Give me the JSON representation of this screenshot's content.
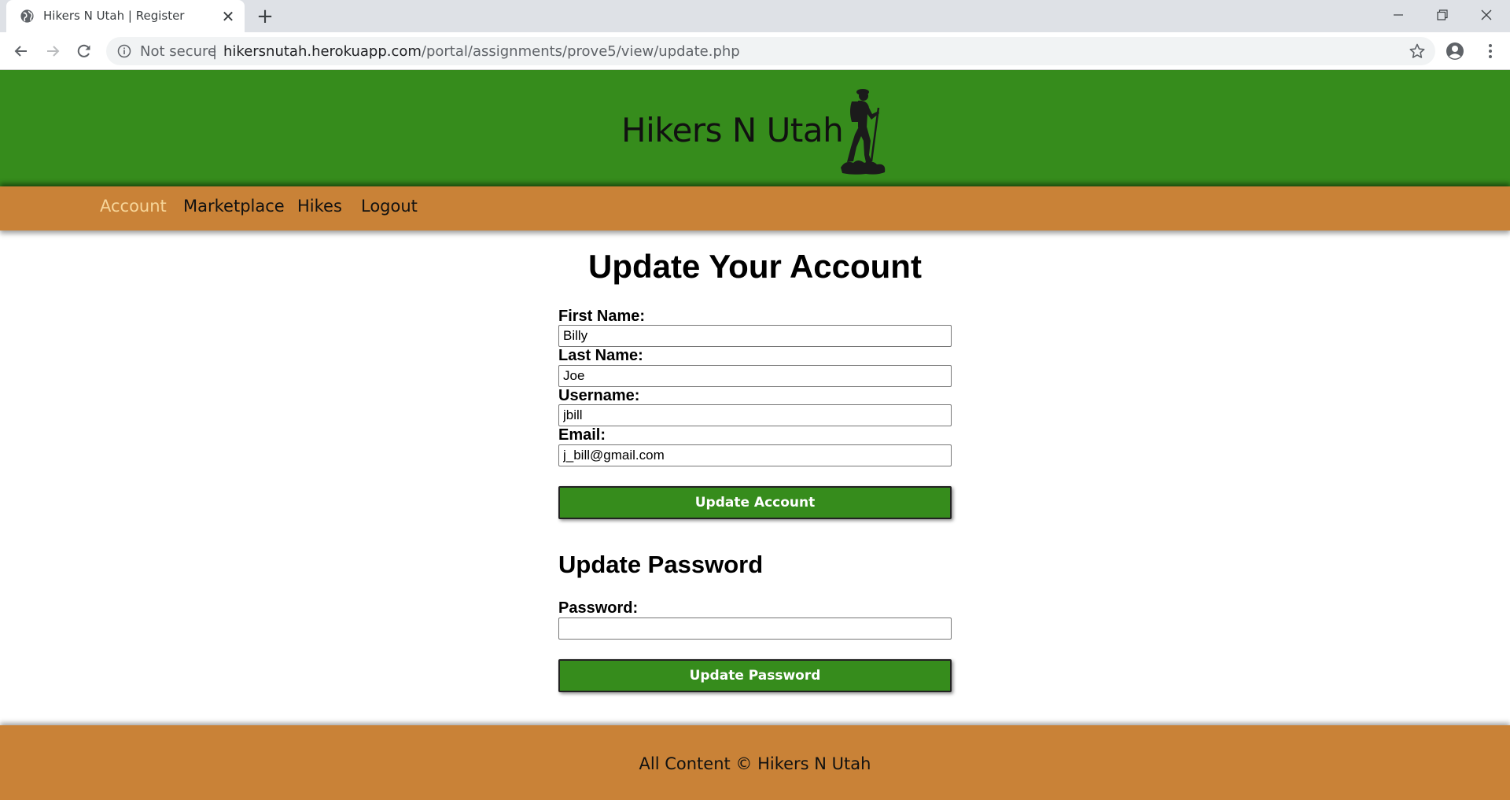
{
  "browser": {
    "tab_title": "Hikers N Utah | Register",
    "close_tab_glyph": "✕",
    "new_tab_glyph": "+",
    "security_label": "Not secure",
    "separator": "|",
    "url_host": "hikersnutah.herokuapp.com",
    "url_path": "/portal/assignments/prove5/view/update.php"
  },
  "site": {
    "title": "Hikers N Utah",
    "logo_icon": "hiker-silhouette-icon",
    "header_color": "#368c1c",
    "nav_color": "#c98237",
    "active_nav_color": "#f7d69a"
  },
  "nav": {
    "items": [
      {
        "label": "Account",
        "active": true
      },
      {
        "label": "Marketplace",
        "active": false
      },
      {
        "label": "Hikes",
        "active": false
      },
      {
        "label": "Logout",
        "active": false
      }
    ]
  },
  "account_form": {
    "heading": "Update Your Account",
    "first_name_label": "First Name:",
    "first_name_value": "Billy",
    "last_name_label": "Last Name:",
    "last_name_value": "Joe",
    "username_label": "Username:",
    "username_value": "jbill",
    "email_label": "Email:",
    "email_value": "j_bill@gmail.com",
    "submit_label": "Update Account"
  },
  "password_form": {
    "heading": "Update Password",
    "password_label": "Password:",
    "password_value": "",
    "submit_label": "Update Password"
  },
  "footer": {
    "text": "All Content © Hikers N Utah"
  }
}
